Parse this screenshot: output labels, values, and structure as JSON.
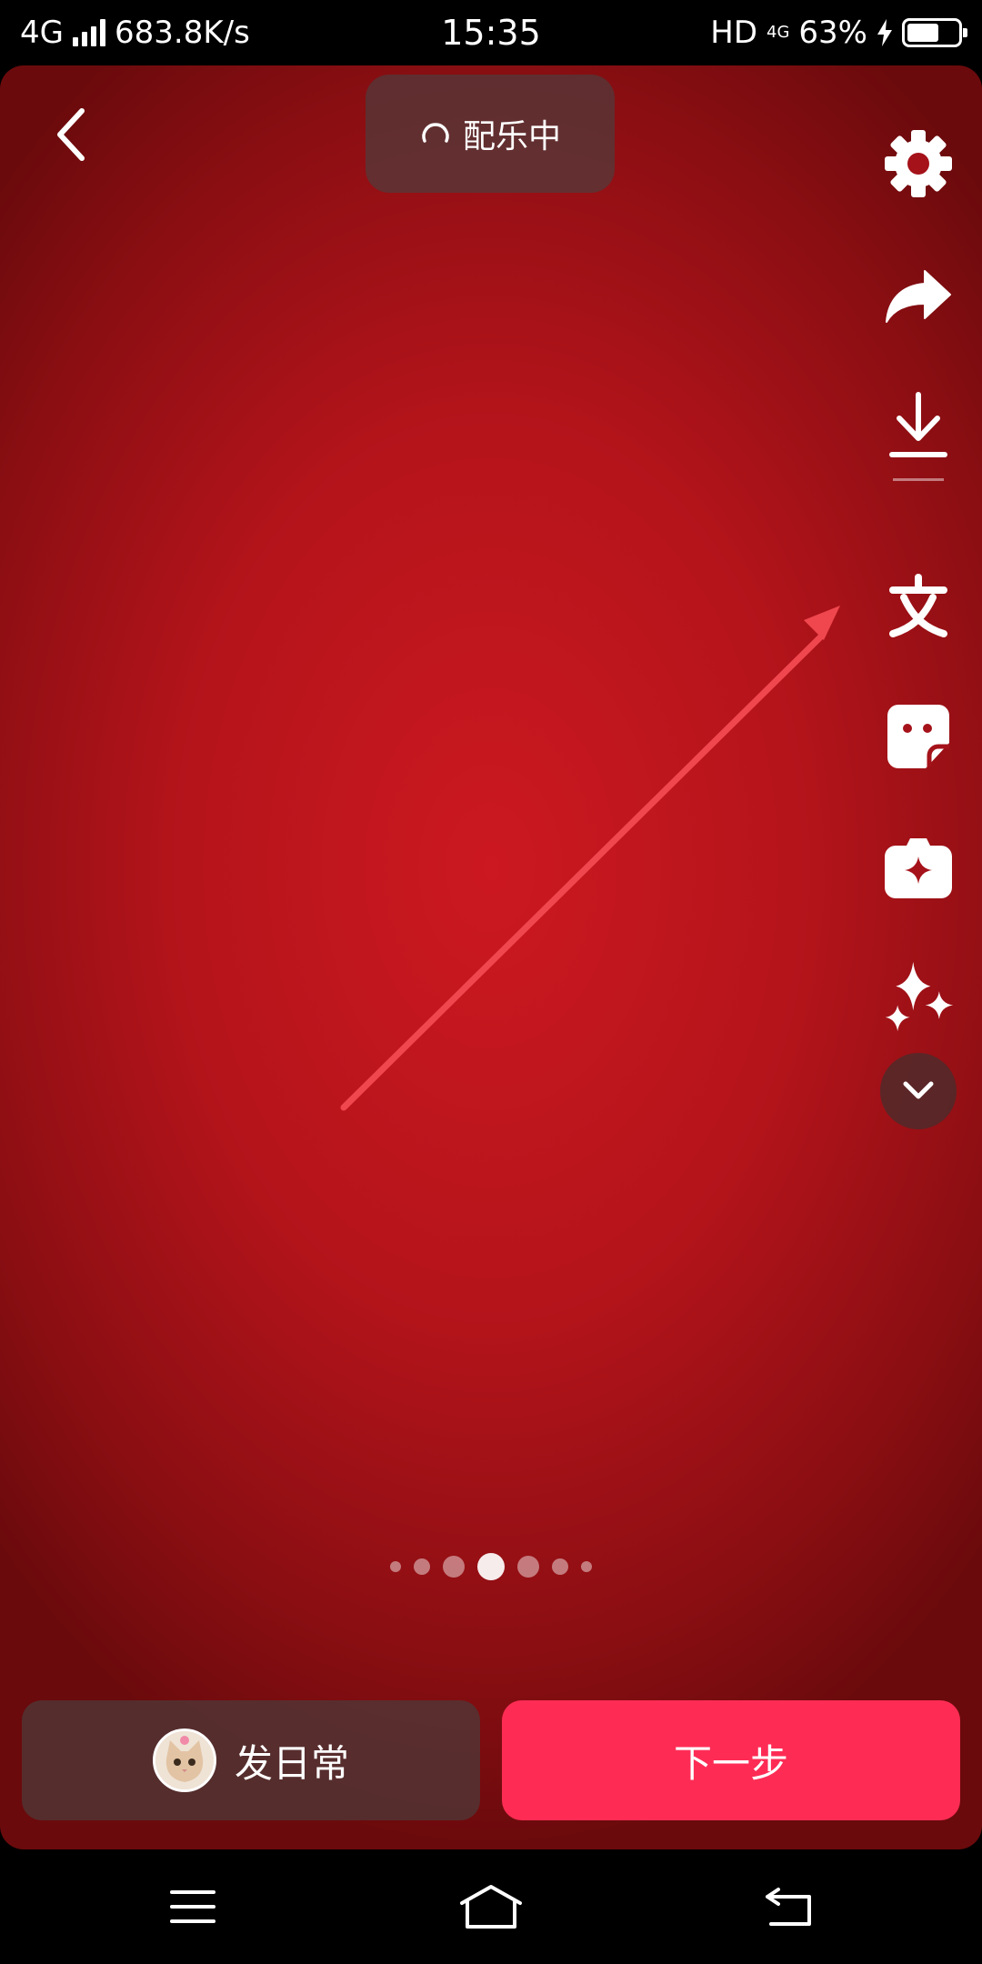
{
  "status_bar": {
    "network": "4G",
    "speed": "683.8K/s",
    "time": "15:35",
    "hd": "HD",
    "network_right": "4G",
    "battery": "63%",
    "battery_level": 0.63
  },
  "top": {
    "music_status": "配乐中"
  },
  "side_tools": [
    "gear-icon",
    "share-icon",
    "download-icon",
    "text-icon",
    "sticker-icon",
    "effect-icon",
    "sparkle-icon",
    "chevron-down-icon"
  ],
  "pager": {
    "count": 7,
    "active_index": 3
  },
  "bottom": {
    "daily_label": "发日常",
    "next_label": "下一步"
  },
  "colors": {
    "background": "#b5141b",
    "accent": "#fe2c55",
    "arrow": "#f0474f"
  }
}
